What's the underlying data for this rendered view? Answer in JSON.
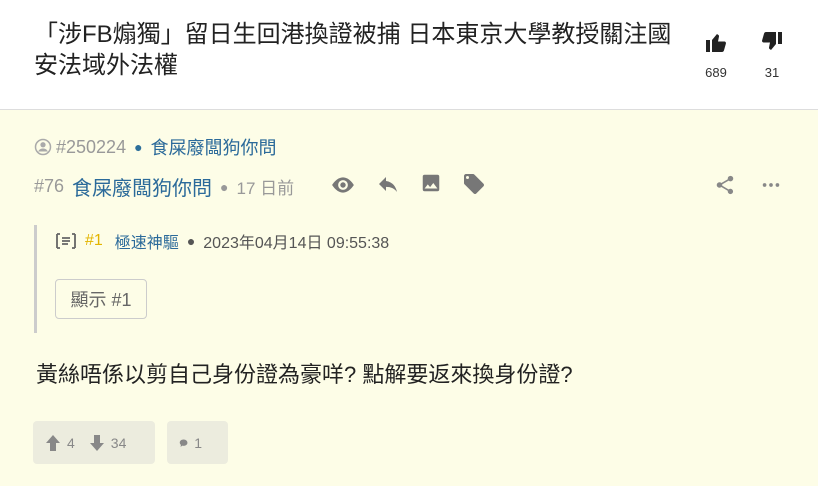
{
  "thread": {
    "title": "「涉FB煽獨」留日生回港換證被捕 日本東京大學教授關注國安法域外法權",
    "likes": "689",
    "dislikes": "31"
  },
  "post": {
    "user_id": "#250224",
    "user_name": "食屎廢闆狗你問",
    "floor": "#76",
    "author": "食屎廢闆狗你問",
    "time_ago": "17 日前",
    "quote": {
      "floor": "#1",
      "author": "極速神驅",
      "timestamp": "2023年04月14日 09:55:38",
      "show_label": "顯示 #1"
    },
    "content": "黃絲唔係以剪自己身份證為豪咩? 點解要返來換身份證?",
    "upvotes": "4",
    "downvotes": "34",
    "replies": "1"
  },
  "icons": [
    "thumb-up-icon",
    "thumb-down-icon",
    "user-icon",
    "eye-icon",
    "reply-icon",
    "image-icon",
    "tag-icon",
    "share-icon",
    "more-icon",
    "quote-icon",
    "arrow-up-icon",
    "arrow-down-icon",
    "comment-icon"
  ]
}
